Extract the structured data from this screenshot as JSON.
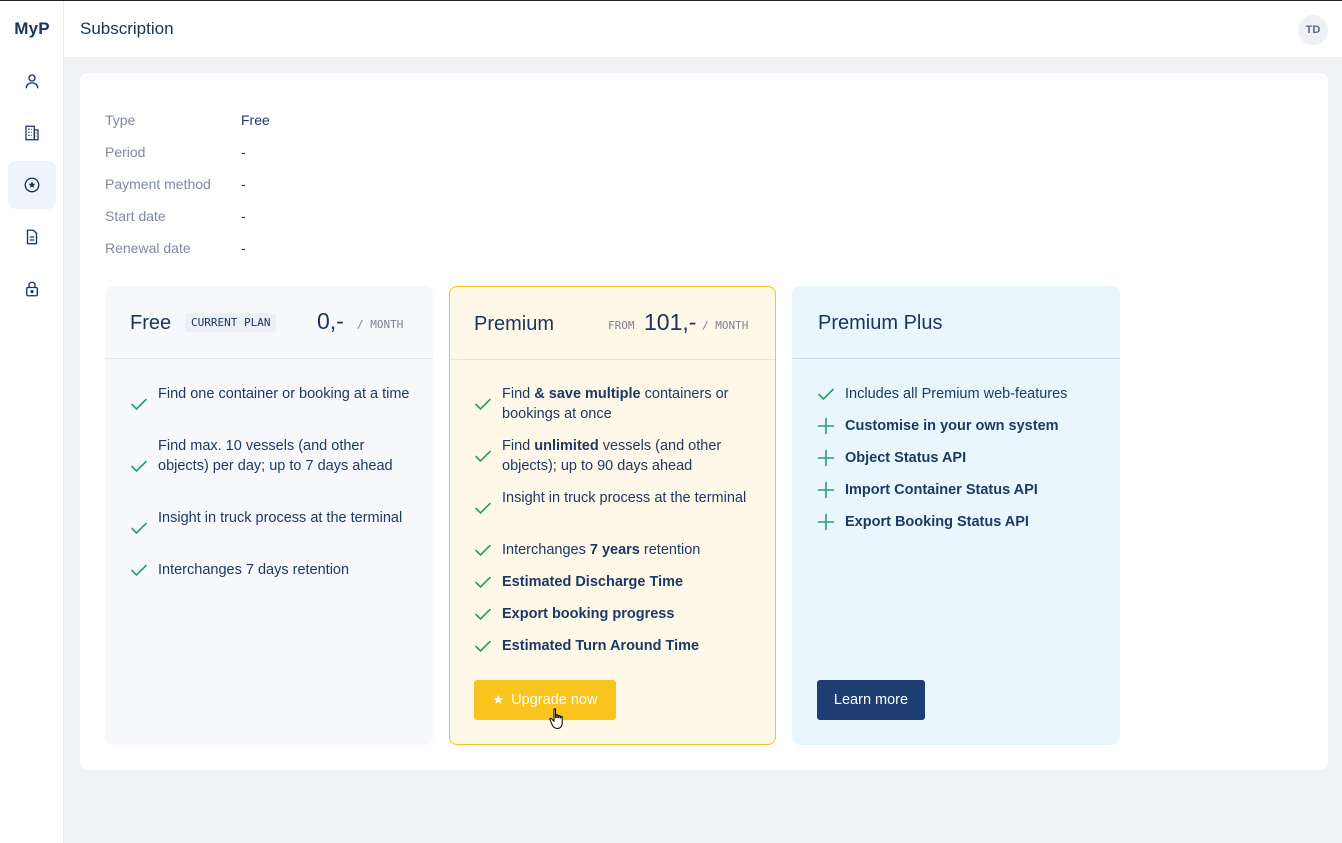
{
  "app": {
    "brand": "MyP",
    "page_title": "Subscription",
    "avatar_initials": "TD"
  },
  "sidebar": {
    "items": [
      {
        "name": "profile",
        "icon": "user-icon"
      },
      {
        "name": "company",
        "icon": "building-icon"
      },
      {
        "name": "subscription",
        "icon": "star-circle-icon",
        "active": true
      },
      {
        "name": "documents",
        "icon": "document-icon"
      },
      {
        "name": "security",
        "icon": "lock-icon"
      }
    ]
  },
  "subscription_info": {
    "type_label": "Type",
    "type_value": "Free",
    "period_label": "Period",
    "period_value": "-",
    "payment_label": "Payment method",
    "payment_value": "-",
    "start_label": "Start date",
    "start_value": "-",
    "renewal_label": "Renewal date",
    "renewal_value": "-"
  },
  "plans": {
    "free": {
      "name": "Free",
      "badge": "CURRENT PLAN",
      "price": "0,-",
      "per": "/ MONTH",
      "features": [
        "Find one container or booking at a time",
        "Find max. 10 vessels (and other objects) per day; up to 7 days ahead",
        "Insight in truck process at the terminal",
        "Interchanges 7 days retention"
      ]
    },
    "premium": {
      "name": "Premium",
      "from": "FROM",
      "price": "101,-",
      "per": "/ MONTH",
      "features": [
        {
          "pre": "Find ",
          "bold": "& save multiple",
          "post": " containers or bookings at once"
        },
        {
          "pre": "Find ",
          "bold": "unlimited",
          "post": " vessels (and other objects); up to 90 days ahead"
        },
        {
          "pre": "",
          "bold": "",
          "post": "Insight in truck process at the terminal"
        },
        {
          "pre": "Interchanges ",
          "bold": "7 years",
          "post": " retention"
        },
        {
          "pre": "",
          "bold": "Estimated Discharge Time",
          "post": ""
        },
        {
          "pre": "",
          "bold": "Export booking progress",
          "post": ""
        },
        {
          "pre": "",
          "bold": "Estimated Turn Around Time",
          "post": ""
        }
      ],
      "button": "Upgrade now"
    },
    "plus": {
      "name": "Premium Plus",
      "features": [
        {
          "mark": "check",
          "text": "Includes all Premium web-features",
          "bold": false
        },
        {
          "mark": "plus",
          "text": "Customise in your own system",
          "bold": true
        },
        {
          "mark": "plus",
          "text": "Object Status API",
          "bold": true
        },
        {
          "mark": "plus",
          "text": "Import Container Status API",
          "bold": true
        },
        {
          "mark": "plus",
          "text": "Export Booking Status API",
          "bold": true
        }
      ],
      "button": "Learn more"
    }
  },
  "colors": {
    "accent_yellow": "#f8c41d",
    "navy": "#1d3d73",
    "check_green": "#2e9a6f",
    "text": "#1c3a63"
  }
}
